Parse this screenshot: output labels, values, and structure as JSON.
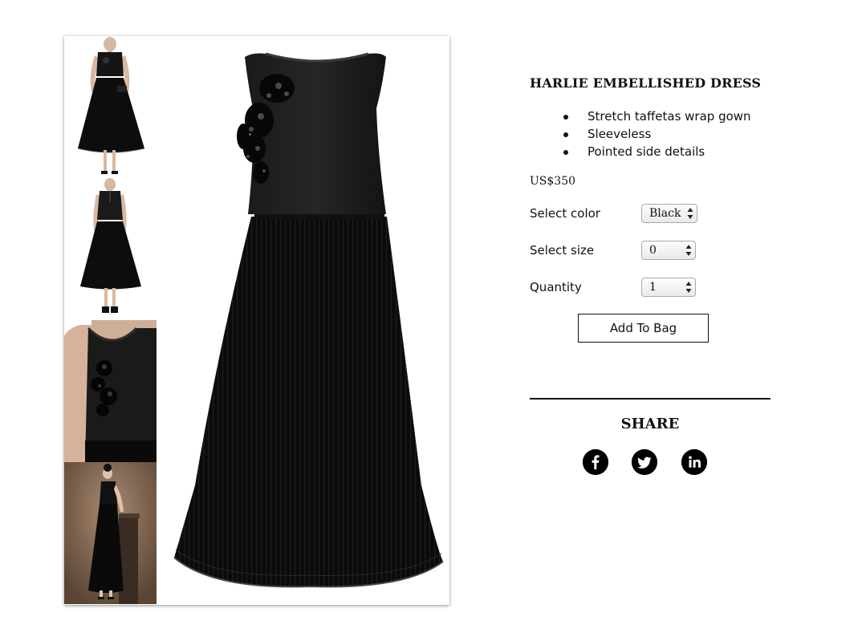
{
  "product": {
    "title": "HARLIE EMBELLISHED DRESS",
    "features": [
      "Stretch taffetas wrap gown",
      "Sleeveless",
      "Pointed side details"
    ],
    "price": "US$350"
  },
  "options": {
    "color": {
      "label": "Select color",
      "value": "Black"
    },
    "size": {
      "label": "Select size",
      "value": "0"
    },
    "quantity": {
      "label": "Quantity",
      "value": "1"
    }
  },
  "add_to_bag_label": "Add To Bag",
  "share": {
    "title": "SHARE",
    "icons": [
      "facebook-icon",
      "twitter-icon",
      "linkedin-icon"
    ]
  },
  "colors": {
    "dress": "#0d0d0d",
    "studio_bg": "#8a6f5c"
  }
}
